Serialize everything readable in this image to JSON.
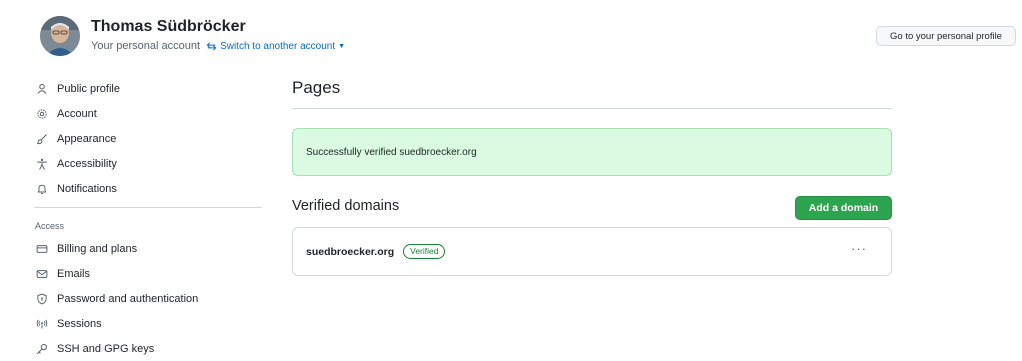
{
  "header": {
    "user_name": "Thomas Südbröcker",
    "account_label": "Your personal account",
    "switch_label": "Switch to another account",
    "profile_button": "Go to your personal profile"
  },
  "sidebar": {
    "items": [
      {
        "label": "Public profile",
        "icon": "person-icon"
      },
      {
        "label": "Account",
        "icon": "gear-icon"
      },
      {
        "label": "Appearance",
        "icon": "paintbrush-icon"
      },
      {
        "label": "Accessibility",
        "icon": "accessibility-icon"
      },
      {
        "label": "Notifications",
        "icon": "bell-icon"
      }
    ],
    "access_heading": "Access",
    "access_items": [
      {
        "label": "Billing and plans",
        "icon": "credit-card-icon"
      },
      {
        "label": "Emails",
        "icon": "mail-icon"
      },
      {
        "label": "Password and authentication",
        "icon": "shield-lock-icon"
      },
      {
        "label": "Sessions",
        "icon": "broadcast-icon"
      },
      {
        "label": "SSH and GPG keys",
        "icon": "key-icon"
      }
    ]
  },
  "main": {
    "title": "Pages",
    "flash_message": "Successfully verified suedbroecker.org",
    "verified_domains_title": "Verified domains",
    "add_domain_button": "Add a domain",
    "domains": [
      {
        "name": "suedbroecker.org",
        "status": "Verified"
      }
    ],
    "more_actions": "···"
  },
  "colors": {
    "accent_link": "#0969da",
    "primary_button": "#2da44e",
    "flash_background": "#dafbe1",
    "verified_badge": "#1a7f37"
  }
}
